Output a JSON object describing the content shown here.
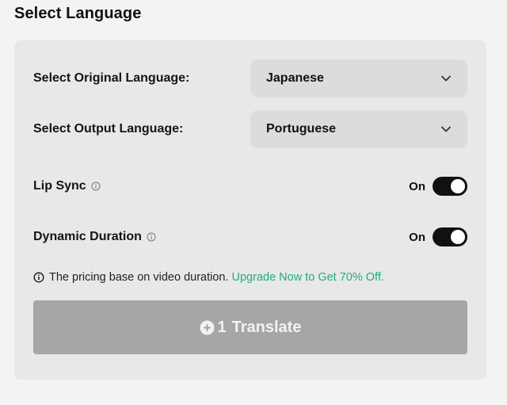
{
  "header": {
    "title": "Select Language"
  },
  "original_language": {
    "label": "Select Original Language:",
    "value": "Japanese"
  },
  "output_language": {
    "label": "Select Output Language:",
    "value": "Portuguese"
  },
  "lip_sync": {
    "label": "Lip Sync",
    "state": "On"
  },
  "dynamic_duration": {
    "label": "Dynamic Duration",
    "state": "On"
  },
  "pricing": {
    "note": "The pricing base on video duration.",
    "upgrade_link": "Upgrade Now to Get 70% Off."
  },
  "translate_button": {
    "credits": "1",
    "label": "Translate"
  },
  "colors": {
    "accent_green": "#1fae7a",
    "toggle_on": "#111111",
    "button_disabled": "#a6a6a6"
  }
}
